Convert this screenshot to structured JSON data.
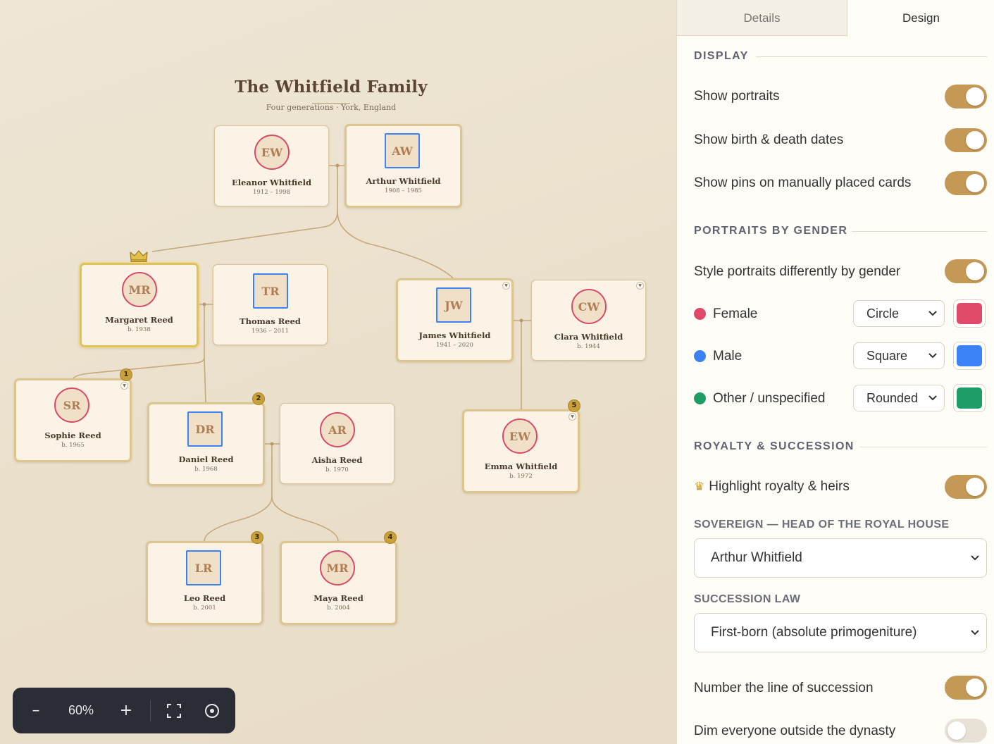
{
  "tree": {
    "title": "The Whitfield Family",
    "subtitle": "Four generations · York, England",
    "people": [
      {
        "id": "eleanor",
        "initials": "EW",
        "name": "Eleanor Whitfield",
        "dates": "1912 – 1998",
        "gender": "female"
      },
      {
        "id": "arthur",
        "initials": "AW",
        "name": "Arthur Whitfield",
        "dates": "1908 – 1985",
        "gender": "male"
      },
      {
        "id": "margaret",
        "initials": "MR",
        "name": "Margaret Reed",
        "dates": "b. 1938",
        "gender": "female"
      },
      {
        "id": "thomas",
        "initials": "TR",
        "name": "Thomas Reed",
        "dates": "1936 – 2011",
        "gender": "male"
      },
      {
        "id": "james",
        "initials": "JW",
        "name": "James Whitfield",
        "dates": "1941 – 2020",
        "gender": "male"
      },
      {
        "id": "clara",
        "initials": "CW",
        "name": "Clara Whitfield",
        "dates": "b. 1944",
        "gender": "female"
      },
      {
        "id": "sophie",
        "initials": "SR",
        "name": "Sophie Reed",
        "dates": "b. 1965",
        "gender": "female",
        "succession": "1"
      },
      {
        "id": "daniel",
        "initials": "DR",
        "name": "Daniel Reed",
        "dates": "b. 1968",
        "gender": "male",
        "succession": "2"
      },
      {
        "id": "aisha",
        "initials": "AR",
        "name": "Aisha Reed",
        "dates": "b. 1970",
        "gender": "female"
      },
      {
        "id": "emma",
        "initials": "EW",
        "name": "Emma Whitfield",
        "dates": "b. 1972",
        "gender": "female",
        "succession": "5"
      },
      {
        "id": "leo",
        "initials": "LR",
        "name": "Leo Reed",
        "dates": "b. 2001",
        "gender": "male",
        "succession": "3"
      },
      {
        "id": "maya",
        "initials": "MR",
        "name": "Maya Reed",
        "dates": "b. 2004",
        "gender": "female",
        "succession": "4"
      }
    ]
  },
  "zoom": {
    "minus": "–",
    "level": "60%",
    "plus": "+",
    "fit_icon": "fit-screen-icon",
    "center_icon": "target-icon"
  },
  "panel": {
    "tabs": {
      "details": "Details",
      "design": "Design"
    },
    "display": {
      "heading": "DISPLAY",
      "show_portraits": "Show portraits",
      "show_dates": "Show birth & death dates",
      "show_pins": "Show pins on manually placed cards"
    },
    "portraits": {
      "heading": "PORTRAITS BY GENDER",
      "style_by_gender": "Style portraits differently by gender",
      "rows": [
        {
          "label": "Female",
          "shape": "Circle",
          "color": "#e04a6a"
        },
        {
          "label": "Male",
          "shape": "Square",
          "color": "#3b82f6"
        },
        {
          "label": "Other / unspecified",
          "shape": "Rounded",
          "color": "#1f9d66"
        }
      ]
    },
    "royalty": {
      "heading": "ROYALTY & SUCCESSION",
      "crown_glyph": "♛",
      "highlight": "Highlight royalty & heirs",
      "sovereign_label": "SOVEREIGN — HEAD OF THE ROYAL HOUSE",
      "sovereign_value": "Arthur Whitfield",
      "law_label": "SUCCESSION LAW",
      "law_value": "First-born (absolute primogeniture)",
      "number_line": "Number the line of succession",
      "dim_outside": "Dim everyone outside the dynasty"
    }
  },
  "colors": {
    "accent": "#c49855",
    "female": "#e04a6a",
    "male": "#3b82f6",
    "other": "#1f9d66"
  }
}
